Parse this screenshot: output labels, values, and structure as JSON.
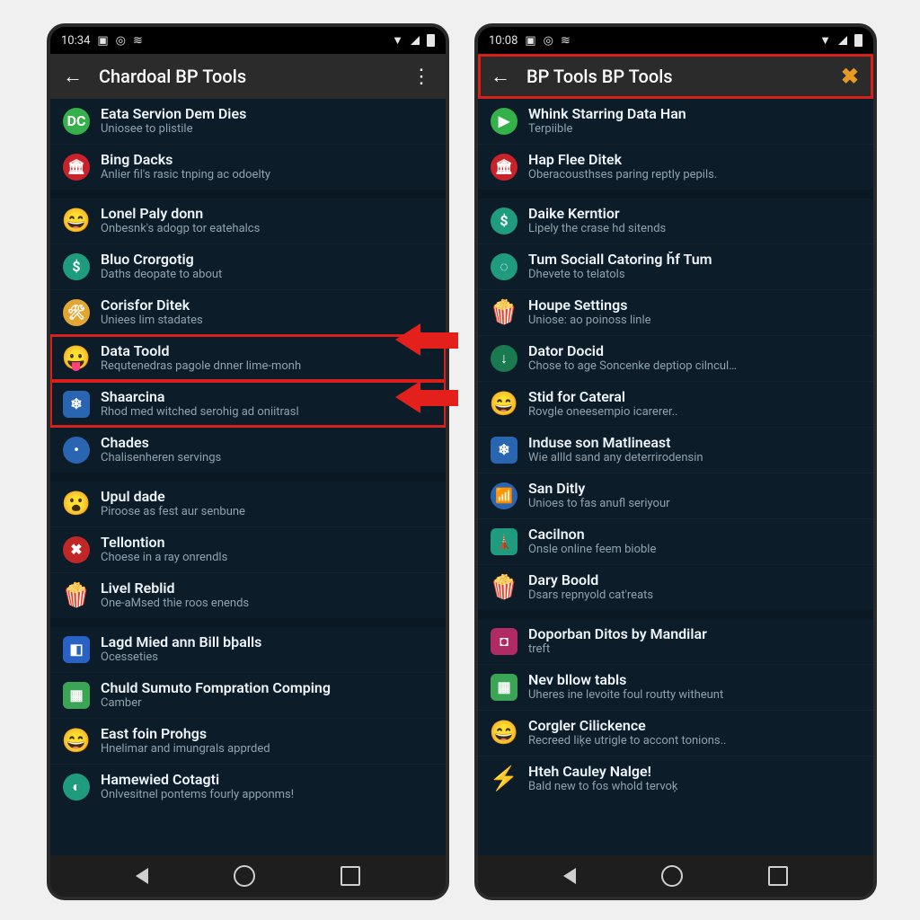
{
  "left": {
    "status": {
      "time": "10:34"
    },
    "appbar": {
      "title": "Chardoal BP Tools"
    },
    "rows": [
      {
        "icon": "DC",
        "bg": "#35b04a",
        "shape": "circ",
        "title": "Eata Servion Dem Dies",
        "sub": "Uniosee to plistile"
      },
      {
        "icon": "🏛",
        "bg": "#c92229",
        "shape": "circ",
        "title": "Bing Dacks",
        "sub": "Anlier fil's rasic tnping ac odoelty"
      },
      {
        "gap": true
      },
      {
        "icon": "😄",
        "em": true,
        "title": "Lonel Paly donn",
        "sub": "Onbesnk's adogp tor eatehalcs"
      },
      {
        "icon": "$",
        "bg": "#1f9c7e",
        "shape": "circ",
        "title": "Bluo Crorgotig",
        "sub": "Daths deopate to about"
      },
      {
        "icon": "🛠",
        "bg": "#e2a733",
        "shape": "circ",
        "title": "Corisfor Ditek",
        "sub": "Uniees lim stadates"
      },
      {
        "icon": "😛",
        "em": true,
        "title": "Data Toold",
        "sub": "Requtenedras pagole dnner lime-monh",
        "box": "red-box"
      },
      {
        "icon": "❄",
        "bg": "#2a65b2",
        "shape": "sq",
        "title": "Shaarcina",
        "sub": "Rhod med witched serohig ad oniitrasl",
        "box": "red-box-2"
      },
      {
        "icon": "•",
        "bg": "#2a65b2",
        "shape": "circ",
        "title": "Chades",
        "sub": "Chalisenheren servings"
      },
      {
        "gap": true
      },
      {
        "icon": "😮",
        "em": true,
        "title": "Upul dade",
        "sub": "Piroose as fest aur senbune"
      },
      {
        "icon": "✖",
        "bg": "#c02727",
        "shape": "circ",
        "title": "Tellontion",
        "sub": "Choese in a ray onrendls"
      },
      {
        "icon": "🍿",
        "em": true,
        "title": "Livel Reblid",
        "sub": "One-aMsed thie roos enends"
      },
      {
        "gap": true
      },
      {
        "icon": "◧",
        "bg": "#2962c4",
        "shape": "sq",
        "title": "Lagd Mied ann Bill bþalls",
        "sub": "Ocesseties"
      },
      {
        "icon": "▦",
        "bg": "#3aa655",
        "shape": "sq",
        "title": "Chuld Sumuto Fompration Comping",
        "sub": "Camber"
      },
      {
        "icon": "😄",
        "em": true,
        "title": "East foin Prohgs",
        "sub": "Hnelimar and imungrals apprded"
      },
      {
        "icon": "◐",
        "bg": "#1f9c7e",
        "shape": "circ",
        "title": "Hamewied Cotagti",
        "sub": "Onlvesitnel pontems fourly apponms!"
      }
    ]
  },
  "right": {
    "status": {
      "time": "10:08"
    },
    "appbar": {
      "title": "BP Tools BP Tools"
    },
    "rows": [
      {
        "icon": "▶",
        "bg": "#34b14a",
        "shape": "circ",
        "title": "Whink Starring Data Han",
        "sub": "Terpiible"
      },
      {
        "icon": "🏛",
        "bg": "#c92229",
        "shape": "circ",
        "title": "Hap Flee Ditek",
        "sub": "Oberacousthses paring reptly pepils."
      },
      {
        "gap": true
      },
      {
        "icon": "$",
        "bg": "#1f9c7e",
        "shape": "circ",
        "title": "Daike Kerntior",
        "sub": "Lipely the crase hd sitends"
      },
      {
        "icon": "◌",
        "bg": "#1f9c7e",
        "shape": "circ",
        "title": "Tum Sociall Catoring ȟf Tum",
        "sub": "Dhevete to telatols"
      },
      {
        "icon": "🍿",
        "em": true,
        "title": "Houpe Settings",
        "sub": "Uniose: ao poinoss linle"
      },
      {
        "icon": "↓",
        "bg": "#1a7a4f",
        "shape": "circ",
        "title": "Dator Docid",
        "sub": "Chose to age Soncenke deptiop cilncul…"
      },
      {
        "icon": "😄",
        "em": true,
        "title": "Stid for Cateral",
        "sub": "Rovgle oneesempio icarerer.."
      },
      {
        "icon": "❄",
        "bg": "#2a65b2",
        "shape": "sq",
        "title": "Induse son Matlineast",
        "sub": "Wie allld sand any deterrirodensin"
      },
      {
        "icon": "📶",
        "bg": "#2a65b2",
        "shape": "circ",
        "title": "San Ditly",
        "sub": "Unioes to fas anufl seriyour"
      },
      {
        "icon": "🗼",
        "bg": "#1f9c7e",
        "shape": "sq",
        "title": "Cacilnon",
        "sub": "Onsle online feem bioble"
      },
      {
        "icon": "🍿",
        "em": true,
        "title": "Dary Boold",
        "sub": "Dsars repnyold cat'reats"
      },
      {
        "gap": true
      },
      {
        "icon": "◘",
        "bg": "#b02a63",
        "shape": "sq",
        "title": "Doporban Ditos by Mandilar",
        "sub": "treft"
      },
      {
        "icon": "▦",
        "bg": "#3aa655",
        "shape": "sq",
        "title": "Nev bllow tabls",
        "sub": "Uheres ine levoite foul routty witheunt"
      },
      {
        "icon": "😄",
        "em": true,
        "title": "Corgler Cilickence",
        "sub": "Recreed liķe utrigle to accont tonions.."
      },
      {
        "icon": "⚡",
        "em": true,
        "title": "Hteh Cauley Nalge!",
        "sub": "Bald new to fos whold tervoķ"
      }
    ]
  },
  "annotations": {
    "arrow_color": "#e4201c",
    "highlight_color": "#d8201a"
  }
}
